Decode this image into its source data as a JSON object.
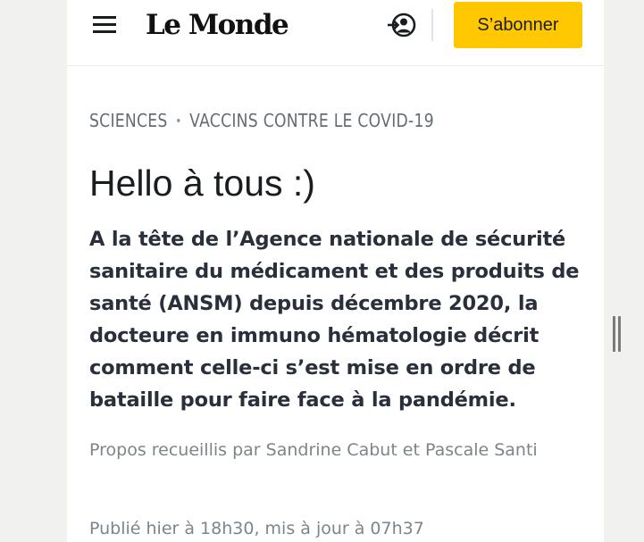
{
  "header": {
    "logo_text": "Le Monde",
    "subscribe_label": "S’abonner",
    "brand_color": "#ffc800"
  },
  "icons": {
    "menu": "hamburger-menu-icon",
    "login": "login-account-icon",
    "scroll": "resize-handle-icon"
  },
  "article": {
    "breadcrumb": [
      "SCIENCES",
      "VACCINS CONTRE LE COVID-19"
    ],
    "breadcrumb_separator": "•",
    "title": "Hello à tous :)",
    "lede": "A la tête de l’Agence nationale de sécurité sanitaire du médicament et des produits de santé (ANSM) depuis décembre 2020, la docteure en immuno hématologie décrit comment celle-ci s’est mise en ordre de bataille pour faire face à la pandémie.",
    "byline": "Propos recueillis par Sandrine Cabut et Pascale Santi",
    "published": "Publié hier à 18h30, mis à jour à 07h37"
  }
}
